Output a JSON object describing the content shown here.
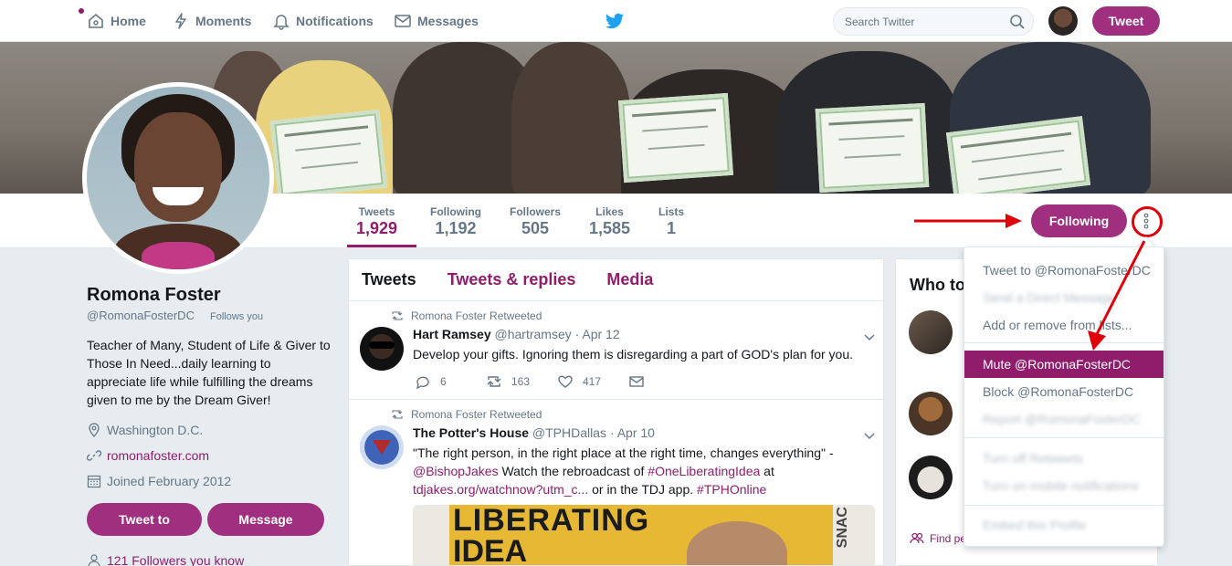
{
  "nav": {
    "home": "Home",
    "moments": "Moments",
    "notifications": "Notifications",
    "messages": "Messages",
    "search_placeholder": "Search Twitter",
    "tweet_button": "Tweet"
  },
  "stats": [
    {
      "label": "Tweets",
      "value": "1,929"
    },
    {
      "label": "Following",
      "value": "1,192"
    },
    {
      "label": "Followers",
      "value": "505"
    },
    {
      "label": "Likes",
      "value": "1,585"
    },
    {
      "label": "Lists",
      "value": "1"
    }
  ],
  "following_button": "Following",
  "profile": {
    "name": "Romona Foster",
    "handle": "@RomonaFosterDC",
    "follows_you": "Follows you",
    "bio": "Teacher of Many, Student of Life & Giver to Those In Need...daily learning to appreciate life while fulfilling the dreams given to me by the Dream Giver!",
    "location": "Washington D.C.",
    "website": "romonafoster.com",
    "joined": "Joined February 2012",
    "tweet_to": "Tweet to",
    "message": "Message",
    "followers_you_know": "121 Followers you know"
  },
  "timeline": {
    "tabs": [
      "Tweets",
      "Tweets & replies",
      "Media"
    ],
    "tweets": [
      {
        "retweeted_by": "Romona Foster Retweeted",
        "name": "Hart Ramsey",
        "handle": "@hartramsey",
        "date": "· Apr 12",
        "text": "Develop your gifts. Ignoring them is disregarding a part of GOD's plan for you.",
        "replies": "6",
        "retweets": "163",
        "likes": "417"
      },
      {
        "retweeted_by": "Romona Foster Retweeted",
        "name": "The Potter's House",
        "handle": "@TPHDallas",
        "date": "· Apr 10",
        "text_1": "\"The right person, in the right place at the right time, changes everything\" -",
        "mention": "@BishopJakes",
        "text_2": " Watch the rebroadcast of ",
        "hashtag": "#OneLiberatingIdea",
        "text_3": " at",
        "link": "tdjakes.org/watchnow?utm_c...",
        "text_4": " or in the TDJ app. ",
        "hashtag2": "#TPHOnline",
        "media_text_1": "LIBERATING",
        "media_text_2": "IDEA",
        "media_side_text": "SNAC"
      }
    ]
  },
  "who_to_follow": {
    "title": "Who to",
    "find_people": "Find pe"
  },
  "dropdown": {
    "items": [
      {
        "label": "Tweet to @RomonaFosterDC"
      },
      {
        "label": "Send a Direct Message"
      },
      {
        "label": "Add or remove from lists..."
      },
      {
        "label": "Mute @RomonaFosterDC"
      },
      {
        "label": "Block @RomonaFosterDC"
      },
      {
        "label": "Report @RomonaFosterDC"
      },
      {
        "label": "Turn off Retweets"
      },
      {
        "label": "Turn on mobile notifications"
      },
      {
        "label": "Embed this Profile"
      }
    ]
  },
  "colors": {
    "accent": "#8f1d6b",
    "button": "#a0307f",
    "annotation_red": "#e0000a"
  }
}
